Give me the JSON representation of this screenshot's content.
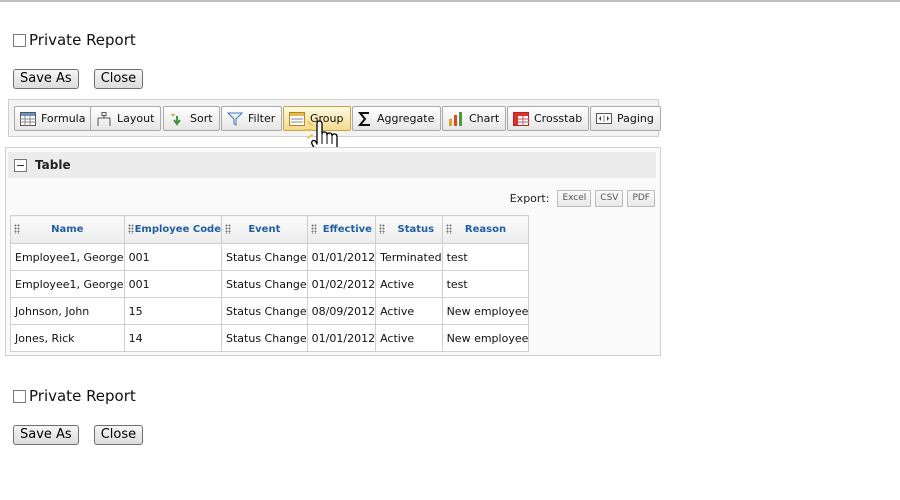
{
  "top": {
    "private_report_label": "Private Report",
    "save_as_label": "Save As",
    "close_label": "Close"
  },
  "toolbar": {
    "buttons": [
      {
        "label": "Formula",
        "icon": "formula-icon"
      },
      {
        "label": "Layout",
        "icon": "layout-icon"
      },
      {
        "label": "Sort",
        "icon": "sort-icon"
      },
      {
        "label": "Filter",
        "icon": "filter-icon"
      },
      {
        "label": "Group",
        "icon": "group-icon",
        "state": "hovered"
      },
      {
        "label": "Aggregate",
        "icon": "sigma-icon"
      },
      {
        "label": "Chart",
        "icon": "bar-chart-icon"
      },
      {
        "label": "Crosstab",
        "icon": "crosstab-icon"
      },
      {
        "label": "Paging",
        "icon": "paging-icon"
      }
    ]
  },
  "panel": {
    "title": "Table",
    "export_label": "Export:",
    "export_buttons": [
      "Excel",
      "CSV",
      "PDF"
    ]
  },
  "table": {
    "columns": [
      "Name",
      "Employee Code",
      "Event",
      "Effective",
      "Status",
      "Reason"
    ],
    "rows": [
      [
        "Employee1, George",
        "001",
        "Status Change",
        "01/01/2012",
        "Terminated",
        "test"
      ],
      [
        "Employee1, George",
        "001",
        "Status Change",
        "01/02/2012",
        "Active",
        "test"
      ],
      [
        "Johnson, John",
        "15",
        "Status Change",
        "08/09/2012",
        "Active",
        "New employee"
      ],
      [
        "Jones, Rick",
        "14",
        "Status Change",
        "01/01/2012",
        "Active",
        "New employee"
      ]
    ]
  },
  "bottom": {
    "private_report_label": "Private Report",
    "save_as_label": "Save As",
    "close_label": "Close"
  },
  "colors": {
    "header_text": "#1f5fa8",
    "hover_button": "#f5d98c",
    "toolbar_bg": "#f3f3f3"
  }
}
